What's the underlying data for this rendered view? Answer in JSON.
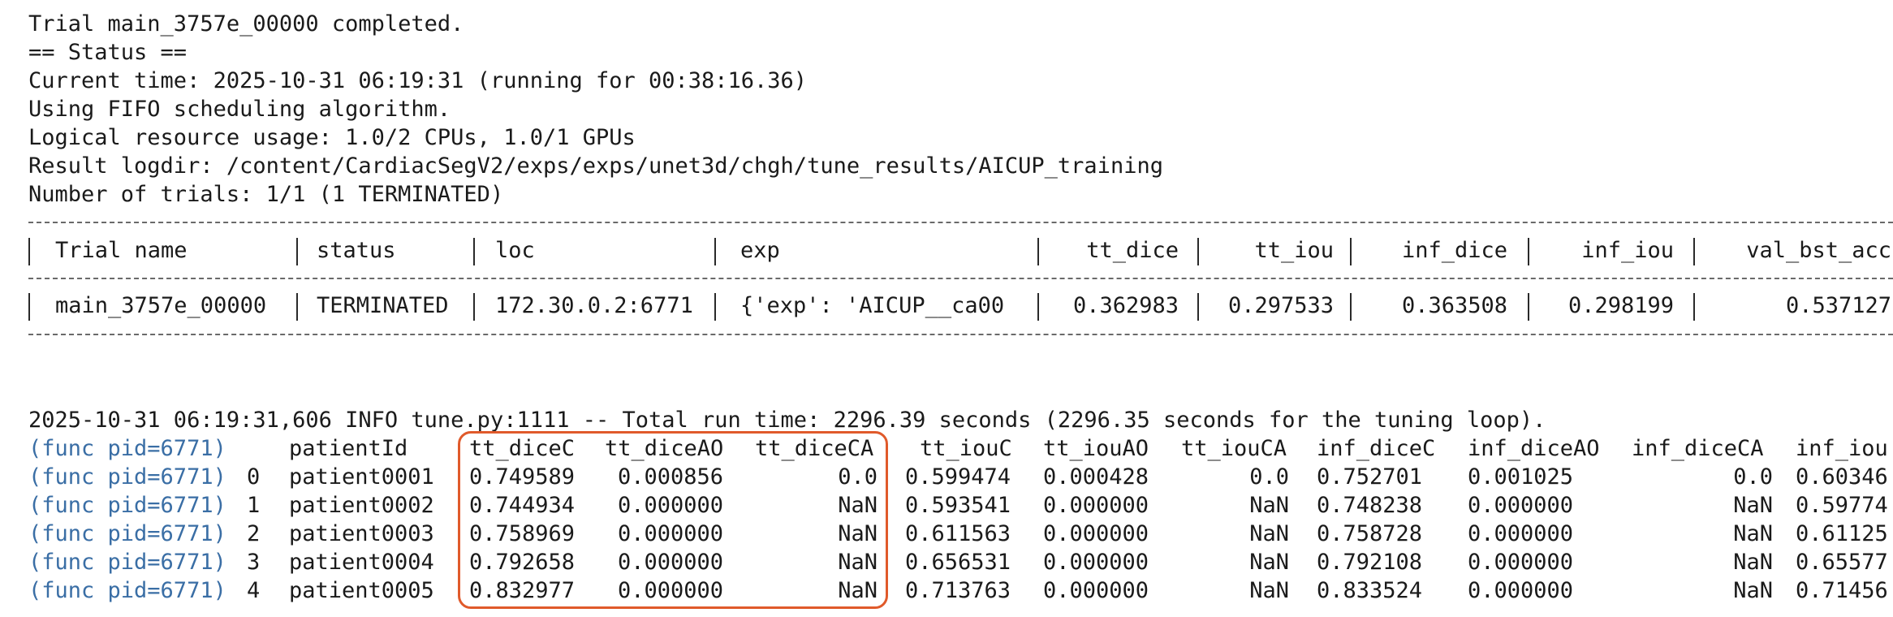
{
  "log": {
    "line_trial_completed": "Trial main_3757e_00000 completed.",
    "line_status_header": "== Status ==",
    "line_current_time": "Current time: 2025-10-31 06:19:31 (running for 00:38:16.36)",
    "line_scheduler": "Using FIFO scheduling algorithm.",
    "line_resources": "Logical resource usage: 1.0/2 CPUs, 1.0/1 GPUs",
    "line_logdir": "Result logdir: /content/CardiacSegV2/exps/exps/unet3d/chgh/tune_results/AICUP_training",
    "line_num_trials": "Number of trials: 1/1 (1 TERMINATED)",
    "line_total_runtime": "2025-10-31 06:19:31,606 INFO tune.py:1111 -- Total run time: 2296.39 seconds (2296.35 seconds for the tuning loop)."
  },
  "trial_table": {
    "headers": [
      "Trial name",
      "status",
      "loc",
      "exp",
      "tt_dice",
      "tt_iou",
      "inf_dice",
      "inf_iou",
      "val_bst_acc"
    ],
    "row": [
      "main_3757e_00000",
      "TERMINATED",
      "172.30.0.2:6771",
      "{'exp': 'AICUP__ca00",
      "0.362983",
      "0.297533",
      "0.363508",
      "0.298199",
      "0.537127"
    ]
  },
  "results": {
    "prefix": "(func pid=6771)",
    "headers": [
      "patientId",
      "tt_diceC",
      "tt_diceAO",
      "tt_diceCA",
      "tt_iouC",
      "tt_iouAO",
      "tt_iouCA",
      "inf_diceC",
      "inf_diceAO",
      "inf_diceCA",
      "inf_iou"
    ],
    "rows": [
      {
        "idx": "0",
        "cells": [
          "patient0001",
          "0.749589",
          "0.000856",
          "0.0",
          "0.599474",
          "0.000428",
          "0.0",
          "0.752701",
          "0.001025",
          "0.0",
          "0.60346"
        ]
      },
      {
        "idx": "1",
        "cells": [
          "patient0002",
          "0.744934",
          "0.000000",
          "NaN",
          "0.593541",
          "0.000000",
          "NaN",
          "0.748238",
          "0.000000",
          "NaN",
          "0.59774"
        ]
      },
      {
        "idx": "2",
        "cells": [
          "patient0003",
          "0.758969",
          "0.000000",
          "NaN",
          "0.611563",
          "0.000000",
          "NaN",
          "0.758728",
          "0.000000",
          "NaN",
          "0.61125"
        ]
      },
      {
        "idx": "3",
        "cells": [
          "patient0004",
          "0.792658",
          "0.000000",
          "NaN",
          "0.656531",
          "0.000000",
          "NaN",
          "0.792108",
          "0.000000",
          "NaN",
          "0.65577"
        ]
      },
      {
        "idx": "4",
        "cells": [
          "patient0005",
          "0.832977",
          "0.000000",
          "NaN",
          "0.713763",
          "0.000000",
          "NaN",
          "0.833524",
          "0.000000",
          "NaN",
          "0.71456"
        ]
      }
    ]
  },
  "highlight_color": "#e05a2b",
  "pid_color": "#3a6ea5"
}
